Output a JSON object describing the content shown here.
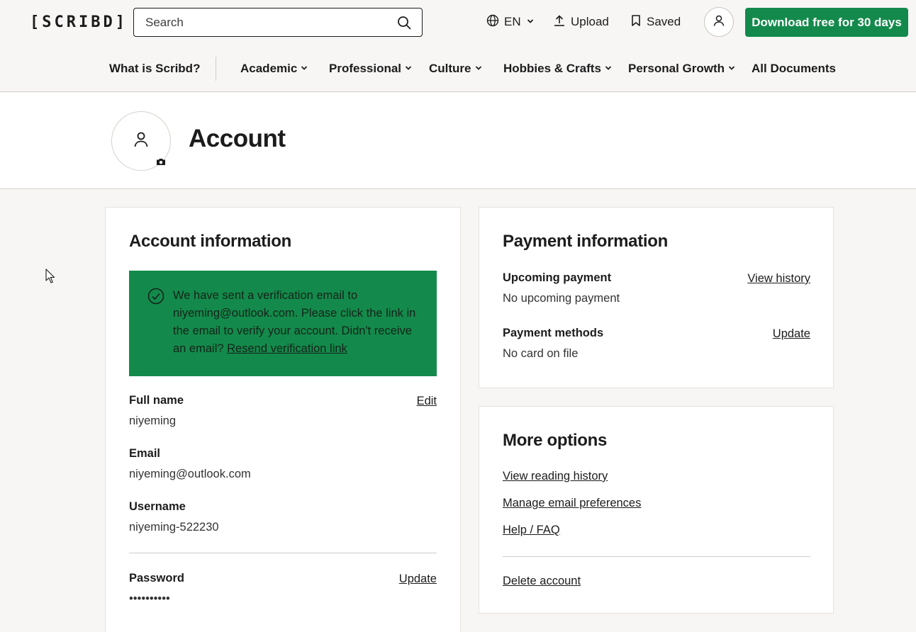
{
  "header": {
    "logo": "[SCRIBD]",
    "search_placeholder": "Search",
    "language": "EN",
    "upload": "Upload",
    "saved": "Saved",
    "cta": "Download free for 30 days"
  },
  "nav": {
    "items": [
      {
        "label": "What is Scribd?",
        "dropdown": false
      },
      {
        "label": "Academic",
        "dropdown": true
      },
      {
        "label": "Professional",
        "dropdown": true
      },
      {
        "label": "Culture",
        "dropdown": true
      },
      {
        "label": "Hobbies & Crafts",
        "dropdown": true
      },
      {
        "label": "Personal Growth",
        "dropdown": true
      },
      {
        "label": "All Documents",
        "dropdown": false
      }
    ]
  },
  "page": {
    "title": "Account"
  },
  "account_info": {
    "heading": "Account information",
    "notice": {
      "text": "We have sent a verification email to niyeming@outlook.com. Please click the link in the email to verify your account. Didn't receive an email?",
      "link": "Resend verification link"
    },
    "full_name": {
      "label": "Full name",
      "value": "niyeming",
      "action": "Edit"
    },
    "email": {
      "label": "Email",
      "value": "niyeming@outlook.com"
    },
    "username": {
      "label": "Username",
      "value": "niyeming-522230"
    },
    "password": {
      "label": "Password",
      "value": "••••••••••",
      "action": "Update"
    }
  },
  "payment_info": {
    "heading": "Payment information",
    "upcoming": {
      "label": "Upcoming payment",
      "value": "No upcoming payment",
      "action": "View history"
    },
    "methods": {
      "label": "Payment methods",
      "value": "No card on file",
      "action": "Update"
    }
  },
  "more_options": {
    "heading": "More options",
    "links": [
      "View reading history",
      "Manage email preferences",
      "Help / FAQ"
    ],
    "delete": "Delete account"
  },
  "colors": {
    "brand_green": "#138a4b",
    "background": "#f7f6f4"
  },
  "icons": [
    "search-icon",
    "globe-icon",
    "chevron-down-icon",
    "upload-icon",
    "bookmark-icon",
    "user-icon",
    "camera-icon",
    "check-circle-icon",
    "cursor-icon"
  ]
}
